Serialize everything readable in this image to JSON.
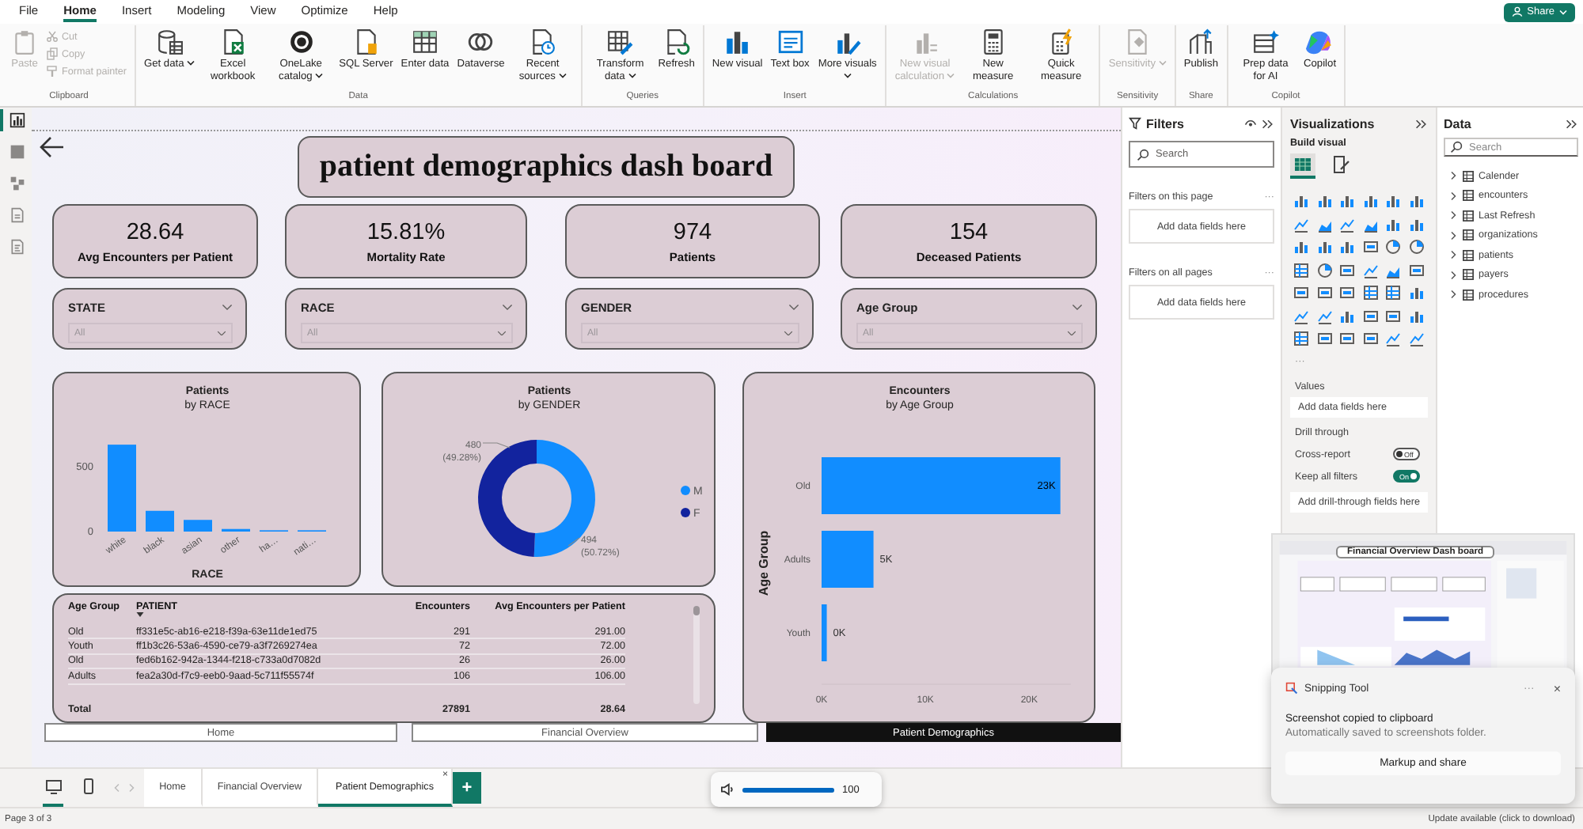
{
  "menu": [
    {
      "label": "File",
      "selected": false
    },
    {
      "label": "Home",
      "selected": true
    },
    {
      "label": "Insert",
      "selected": false
    },
    {
      "label": "Modeling",
      "selected": false
    },
    {
      "label": "View",
      "selected": false
    },
    {
      "label": "Optimize",
      "selected": false
    },
    {
      "label": "Help",
      "selected": false
    }
  ],
  "share_button": "Share",
  "ribbon": [
    {
      "label": "Clipboard",
      "buttons": [
        {
          "label": "Paste",
          "kind": "large",
          "disabled": true,
          "dropdown": false
        },
        {
          "label": "Cut",
          "kind": "small",
          "disabled": true,
          "dropdown": false
        },
        {
          "label": "Copy",
          "kind": "small",
          "disabled": true,
          "dropdown": false
        },
        {
          "label": "Format painter",
          "kind": "small",
          "disabled": true,
          "dropdown": false
        }
      ]
    },
    {
      "label": "Data",
      "buttons": [
        {
          "label": "Get data",
          "kind": "large",
          "disabled": false,
          "dropdown": true
        },
        {
          "label": "Excel workbook",
          "kind": "large",
          "disabled": false,
          "dropdown": false
        },
        {
          "label": "OneLake catalog",
          "kind": "large",
          "disabled": false,
          "dropdown": true
        },
        {
          "label": "SQL Server",
          "kind": "large",
          "disabled": false,
          "dropdown": false
        },
        {
          "label": "Enter data",
          "kind": "large",
          "disabled": false,
          "dropdown": false
        },
        {
          "label": "Dataverse",
          "kind": "large",
          "disabled": false,
          "dropdown": false
        },
        {
          "label": "Recent sources",
          "kind": "large",
          "disabled": false,
          "dropdown": true
        }
      ]
    },
    {
      "label": "Queries",
      "buttons": [
        {
          "label": "Transform data",
          "kind": "large",
          "disabled": false,
          "dropdown": true
        },
        {
          "label": "Refresh",
          "kind": "large",
          "disabled": false,
          "dropdown": false
        }
      ]
    },
    {
      "label": "Insert",
      "buttons": [
        {
          "label": "New visual",
          "kind": "large",
          "disabled": false,
          "dropdown": false
        },
        {
          "label": "Text box",
          "kind": "large",
          "disabled": false,
          "dropdown": false
        },
        {
          "label": "More visuals",
          "kind": "large",
          "disabled": false,
          "dropdown": true
        }
      ]
    },
    {
      "label": "Calculations",
      "buttons": [
        {
          "label": "New visual calculation",
          "kind": "large",
          "disabled": true,
          "dropdown": true
        },
        {
          "label": "New measure",
          "kind": "large",
          "disabled": false,
          "dropdown": false
        },
        {
          "label": "Quick measure",
          "kind": "large",
          "disabled": false,
          "dropdown": false
        }
      ]
    },
    {
      "label": "Sensitivity",
      "buttons": [
        {
          "label": "Sensitivity",
          "kind": "large",
          "disabled": true,
          "dropdown": true
        }
      ]
    },
    {
      "label": "Share",
      "buttons": [
        {
          "label": "Publish",
          "kind": "large",
          "disabled": false,
          "dropdown": false
        }
      ]
    },
    {
      "label": "Copilot",
      "buttons": [
        {
          "label": "Prep data for AI",
          "kind": "large",
          "disabled": false,
          "dropdown": false
        },
        {
          "label": "Copilot",
          "kind": "large",
          "disabled": false,
          "dropdown": false
        }
      ]
    }
  ],
  "view_rail": [
    {
      "selected": true
    },
    {
      "selected": false
    },
    {
      "selected": false
    },
    {
      "selected": false
    },
    {
      "selected": false
    }
  ],
  "report": {
    "title": "patient demographics dash board",
    "kpis": [
      {
        "value": "28.64",
        "label": "Avg Encounters per Patient"
      },
      {
        "value": "15.81%",
        "label": "Mortality Rate"
      },
      {
        "value": "974",
        "label": "Patients"
      },
      {
        "value": "154",
        "label": "Deceased Patients"
      }
    ],
    "slicers": [
      {
        "label": "STATE",
        "value": "All"
      },
      {
        "label": "RACE",
        "value": "All"
      },
      {
        "label": "GENDER",
        "value": "All"
      },
      {
        "label": "Age Group",
        "value": "All"
      }
    ],
    "race_chart": {
      "title": "Patients",
      "subtitle": "by RACE",
      "chart_data": {
        "type": "bar",
        "xlabel": "RACE",
        "categories": [
          "white",
          "black",
          "asian",
          "other",
          "ha…",
          "nati…"
        ],
        "series": [
          {
            "color": "#118dff",
            "values": [
              670,
              160,
              90,
              20,
              10,
              10
            ]
          }
        ],
        "ylim": [
          0,
          700
        ],
        "yticks": [
          0,
          500
        ]
      }
    },
    "gender_chart": {
      "title": "Patients",
      "subtitle": "by GENDER",
      "chart_data": {
        "type": "donut",
        "categories": [
          "M",
          "F"
        ],
        "values": [
          494,
          480
        ],
        "colors": [
          "#118dff",
          "#12239e"
        ],
        "legend": "right",
        "data_labels": true
      },
      "slice_labels": [
        {
          "value": "494",
          "percent": "(50.72%)"
        },
        {
          "value": "480",
          "percent": "(49.28%)"
        }
      ]
    },
    "age_chart": {
      "title": "Encounters",
      "subtitle": "by Age Group",
      "chart_data": {
        "type": "bar",
        "orientation": "horizontal",
        "ylabel": "Age Group",
        "categories": [
          "Old",
          "Adults",
          "Youth"
        ],
        "series": [
          {
            "color": "#118dff",
            "values": [
              23000,
              5000,
              500
            ]
          }
        ],
        "xlim": [
          0,
          24000
        ],
        "xticks": [
          {
            "value": 0,
            "label": "0K"
          },
          {
            "value": 10000,
            "label": "10K"
          },
          {
            "value": 20000,
            "label": "20K"
          }
        ],
        "value_labels": [
          "23K",
          "5K",
          "0K"
        ]
      }
    },
    "table": {
      "columns": [
        {
          "label": "Age Group",
          "sorted": false
        },
        {
          "label": "PATIENT",
          "sorted": true
        },
        {
          "label": "Encounters",
          "sorted": false
        },
        {
          "label": "Avg Encounters per Patient",
          "sorted": false
        }
      ],
      "rows": [
        [
          "Old",
          "ff331e5c-ab16-e218-f39a-63e11de1ed75",
          "291",
          "291.00"
        ],
        [
          "Youth",
          "ff1b3c26-53a6-4590-ce79-a3f7269274ea",
          "72",
          "72.00"
        ],
        [
          "Old",
          "fed6b162-942a-1344-f218-c733a0d7082d",
          "26",
          "26.00"
        ],
        [
          "Adults",
          "fea2a30d-f7c9-eeb0-9aad-5c711f55574f",
          "106",
          "106.00"
        ]
      ],
      "total": {
        "label": "Total",
        "encounters": "27891",
        "avg": "28.64"
      }
    },
    "page_buttons": [
      {
        "label": "Home",
        "selected": false
      },
      {
        "label": "Financial Overview",
        "selected": false
      },
      {
        "label": "Patient Demographics",
        "selected": true
      }
    ]
  },
  "filters": {
    "title": "Filters",
    "search": {
      "placeholder": "Search"
    },
    "sections": [
      {
        "label": "Filters on this page",
        "more": "···",
        "drop": "Add data fields here"
      },
      {
        "label": "Filters on all pages",
        "more": "···",
        "drop": "Add data fields here"
      }
    ]
  },
  "visualizations": {
    "title": "Visualizations",
    "subtitle": "Build visual",
    "build_tabs": [
      {
        "selected": true
      },
      {
        "selected": false
      }
    ],
    "more": "···",
    "values": {
      "label": "Values",
      "drop": "Add data fields here"
    },
    "drill_through": {
      "label": "Drill through",
      "toggles": [
        {
          "label": "Cross-report",
          "on": false,
          "state_text": "Off"
        },
        {
          "label": "Keep all filters",
          "on": true,
          "state_text": "On"
        }
      ],
      "drop": "Add drill-through fields here"
    }
  },
  "data": {
    "title": "Data",
    "search": {
      "placeholder": "Search"
    },
    "tables": [
      {
        "name": "Calender",
        "expanded": false
      },
      {
        "name": "encounters",
        "expanded": false
      },
      {
        "name": "Last Refresh",
        "expanded": false
      },
      {
        "name": "organizations",
        "expanded": false
      },
      {
        "name": "patients",
        "expanded": false
      },
      {
        "name": "payers",
        "expanded": false
      },
      {
        "name": "procedures",
        "expanded": false
      }
    ]
  },
  "page_tabs": {
    "views": [
      {
        "selected": true
      },
      {
        "selected": false
      }
    ],
    "tabs": [
      {
        "label": "Home",
        "selected": false
      },
      {
        "label": "Financial Overview",
        "selected": false
      },
      {
        "label": "Patient Demographics",
        "selected": true
      }
    ],
    "close": "×",
    "add": "+"
  },
  "status_bar": {
    "page": "Page 3 of 3",
    "update": "Update available (click to download)"
  },
  "volume": {
    "level": 1,
    "reading": "100"
  },
  "notification": {
    "thumbnail_title": "Financial Overview Dash board",
    "app": "Snipping Tool",
    "more": "···",
    "close": "×",
    "message": "Screenshot copied to clipboard",
    "detail": "Automatically saved to screenshots folder.",
    "button": "Markup and share"
  }
}
